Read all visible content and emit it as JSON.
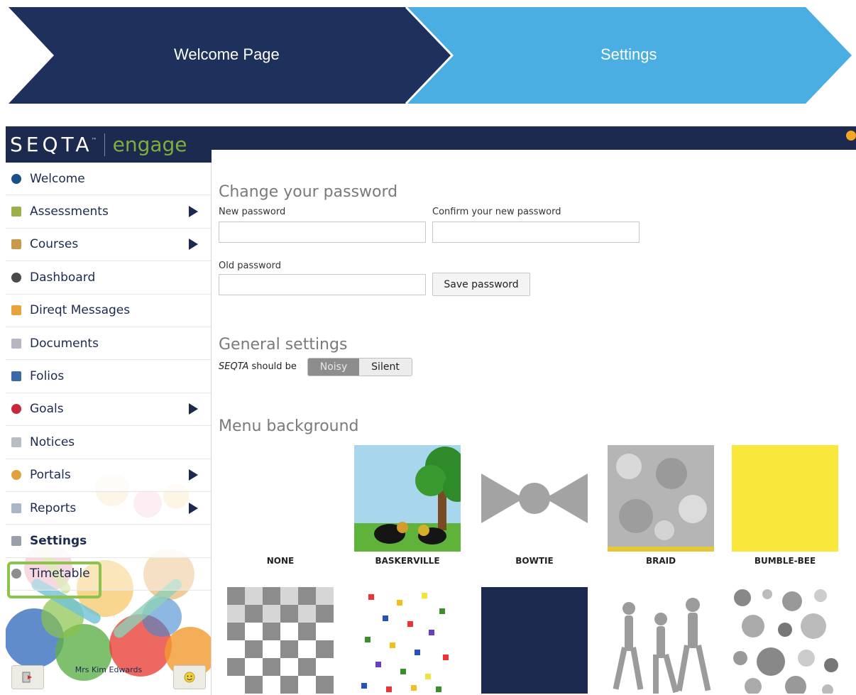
{
  "breadcrumbs": [
    {
      "label": "Welcome Page"
    },
    {
      "label": "Settings"
    }
  ],
  "app": {
    "logo": {
      "brand": "SEQTA",
      "tm": "™",
      "product": "engage"
    },
    "colors": {
      "navy": "#1b2a4e",
      "breadcrumb_light": "#4aaee3",
      "highlight": "#8cc34a",
      "engage_green": "#7fae3d"
    }
  },
  "sidebar": {
    "items": [
      {
        "label": "Welcome",
        "icon": "info-icon",
        "has_submenu": false
      },
      {
        "label": "Assessments",
        "icon": "assessments-icon",
        "has_submenu": true
      },
      {
        "label": "Courses",
        "icon": "courses-icon",
        "has_submenu": true
      },
      {
        "label": "Dashboard",
        "icon": "dashboard-icon",
        "has_submenu": false
      },
      {
        "label": "Direqt Messages",
        "icon": "messages-icon",
        "has_submenu": false
      },
      {
        "label": "Documents",
        "icon": "documents-icon",
        "has_submenu": false
      },
      {
        "label": "Folios",
        "icon": "folios-icon",
        "has_submenu": false
      },
      {
        "label": "Goals",
        "icon": "goals-icon",
        "has_submenu": true
      },
      {
        "label": "Notices",
        "icon": "notices-icon",
        "has_submenu": false
      },
      {
        "label": "Portals",
        "icon": "portals-icon",
        "has_submenu": true
      },
      {
        "label": "Reports",
        "icon": "reports-icon",
        "has_submenu": true
      },
      {
        "label": "Settings",
        "icon": "settings-icon",
        "has_submenu": false,
        "active": true
      },
      {
        "label": "Timetable",
        "icon": "timetable-icon",
        "has_submenu": false
      }
    ],
    "user": {
      "name": "Mrs Kim Edwards"
    }
  },
  "main": {
    "password": {
      "title": "Change your password",
      "new_label": "New password",
      "confirm_label": "Confirm your new password",
      "old_label": "Old password",
      "save_button": "Save password"
    },
    "general": {
      "title": "General settings",
      "prefix_italic": "SEQTA",
      "prefix_rest": " should be",
      "option_on": "Noisy",
      "option_off": "Silent",
      "selected": "Noisy"
    },
    "menu_background": {
      "title": "Menu background",
      "tiles": [
        {
          "label": "NONE"
        },
        {
          "label": "BASKERVILLE"
        },
        {
          "label": "BOWTIE"
        },
        {
          "label": "BRAID"
        },
        {
          "label": "BUMBLE-BEE"
        },
        {
          "label": ""
        },
        {
          "label": ""
        },
        {
          "label": ""
        },
        {
          "label": ""
        },
        {
          "label": ""
        }
      ]
    }
  }
}
